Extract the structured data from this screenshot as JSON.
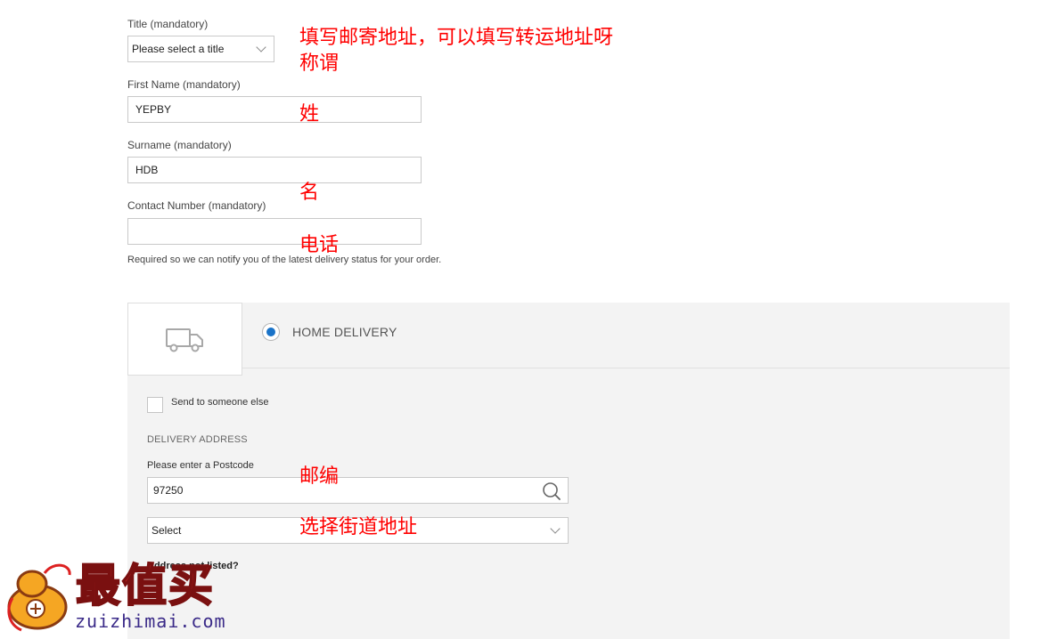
{
  "form": {
    "title_label": "Title (mandatory)",
    "title_value": "Please select a title",
    "first_name_label": "First Name (mandatory)",
    "first_name_value": "YEPBY",
    "surname_label": "Surname (mandatory)",
    "surname_value": "HDB",
    "contact_label": "Contact Number (mandatory)",
    "contact_value": "",
    "contact_helper": "Required so we can notify you of the latest delivery status for your order."
  },
  "annotations": {
    "title_note_line1": "填写邮寄地址，可以填写转运地址呀",
    "title_note_line2": "称谓",
    "first_name_note": "姓",
    "surname_note": "名",
    "contact_note": "电话",
    "postcode_note": "邮编",
    "street_note": "选择街道地址"
  },
  "delivery": {
    "option_label": "HOME DELIVERY",
    "option_selected": true,
    "send_to_else_label": "Send to someone else",
    "address_heading": "DELIVERY ADDRESS",
    "postcode_label": "Please enter a Postcode",
    "postcode_value": "97250",
    "street_select_value": "Select",
    "address_not_listed_partial": "Address not listed?"
  },
  "watermark": {
    "logo_text": "最值买",
    "domain": "zuizhimai.com"
  },
  "colors": {
    "annotation_red": "#ff0000",
    "radio_blue": "#1a73c8",
    "panel_bg": "#f3f3f3"
  },
  "icons": {
    "truck": "truck-icon",
    "search": "search-icon",
    "chevron": "chevron-down-icon"
  }
}
